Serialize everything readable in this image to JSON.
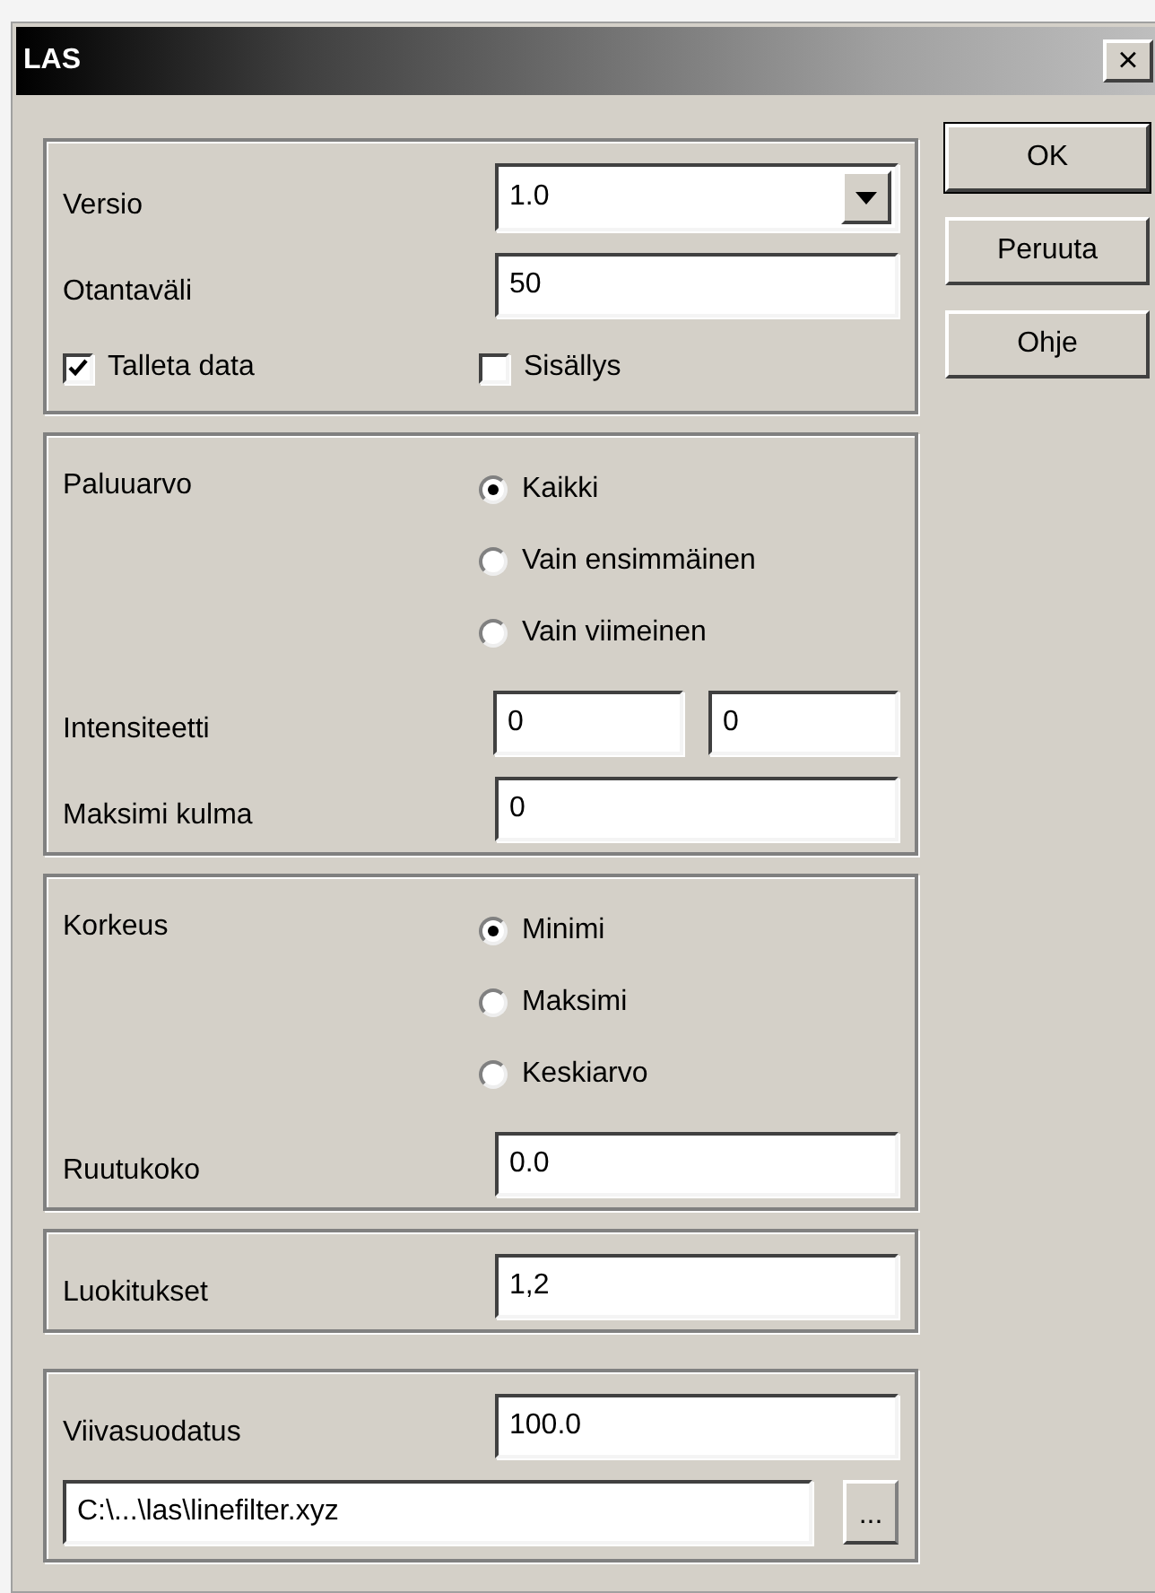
{
  "window": {
    "title": "LAS",
    "close": "×"
  },
  "groups": [
    {
      "rows": [
        {
          "kind": "select",
          "label": "Versio",
          "value": "1.0"
        },
        {
          "kind": "text",
          "label": "Otantaväli",
          "value": "50"
        },
        {
          "kind": "checks",
          "items": [
            {
              "label": "Talleta data",
              "checked": true
            },
            {
              "label": "Sisällys",
              "checked": false
            }
          ]
        }
      ]
    },
    {
      "rows": [
        {
          "kind": "radios",
          "label": "Paluuarvo",
          "options": [
            {
              "label": "Kaikki",
              "selected": true
            },
            {
              "label": "Vain ensimmäinen",
              "selected": false
            },
            {
              "label": "Vain viimeinen",
              "selected": false
            }
          ]
        },
        {
          "kind": "pair",
          "label": "Intensiteetti",
          "values": [
            "0",
            "0"
          ]
        },
        {
          "kind": "text",
          "label": "Maksimi kulma",
          "value": "0"
        }
      ]
    },
    {
      "rows": [
        {
          "kind": "radios",
          "label": "Korkeus",
          "options": [
            {
              "label": "Minimi",
              "selected": true
            },
            {
              "label": "Maksimi",
              "selected": false
            },
            {
              "label": "Keskiarvo",
              "selected": false
            }
          ]
        },
        {
          "kind": "text",
          "label": "Ruutukoko",
          "value": "0.0"
        }
      ]
    },
    {
      "rows": [
        {
          "kind": "text",
          "label": "Luokitukset",
          "value": "1,2"
        }
      ]
    },
    {
      "rows": [
        {
          "kind": "text",
          "label": "Viivasuodatus",
          "value": "100.0"
        },
        {
          "kind": "file",
          "value": "C:\\...\\las\\linefilter.xyz",
          "browse": "..."
        }
      ]
    }
  ],
  "buttons": [
    {
      "label": "OK",
      "default": true
    },
    {
      "label": "Peruuta",
      "default": false
    },
    {
      "label": "Ohje",
      "default": false
    }
  ]
}
